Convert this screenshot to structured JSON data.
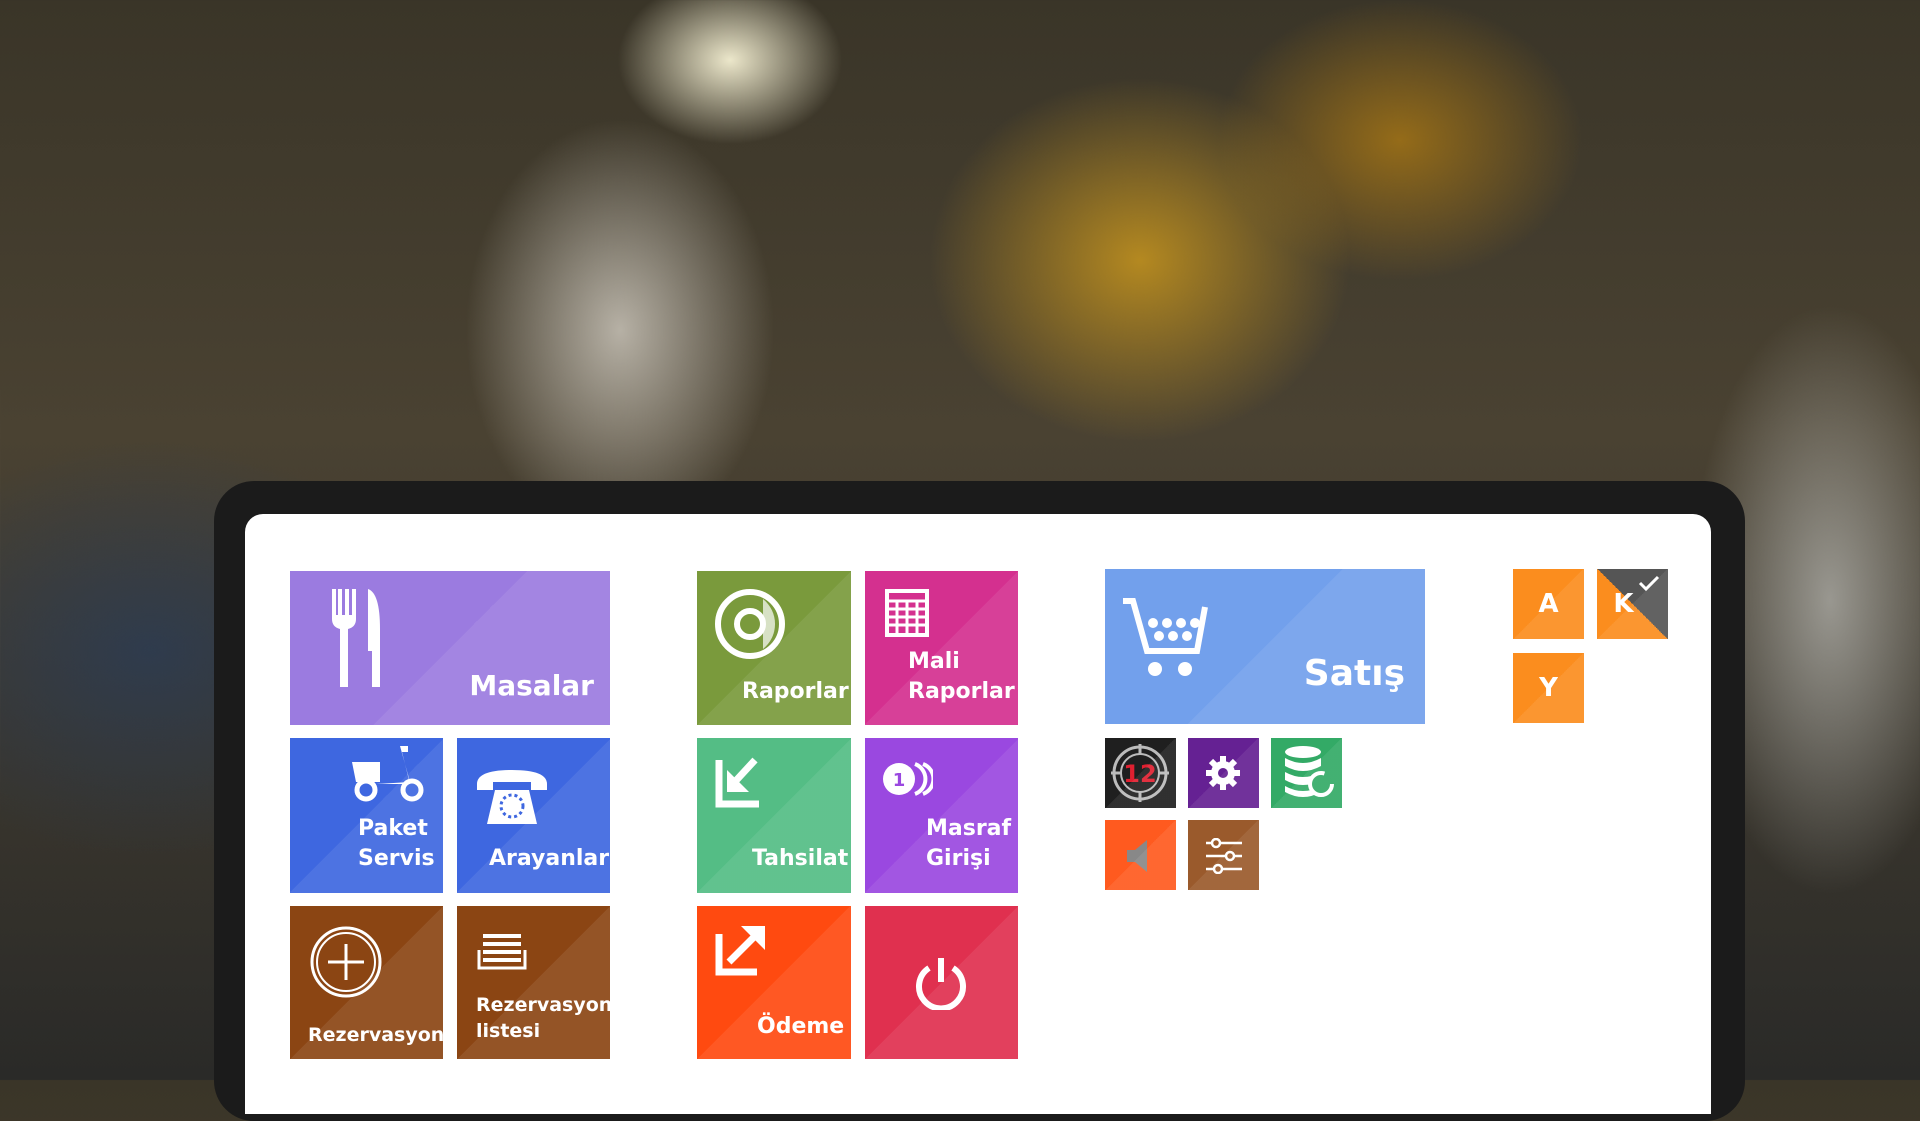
{
  "tiles": {
    "masalar": {
      "label": "Masalar",
      "color": "#9b7be0",
      "icon": "fork-knife-icon"
    },
    "paket_servis": {
      "label_line1": "Paket",
      "label_line2": "Servis",
      "color": "#3e67e0",
      "icon": "scooter-icon"
    },
    "arayanlar": {
      "label": "Arayanlar",
      "color": "#3e67e0",
      "icon": "telephone-icon"
    },
    "rezervasyon": {
      "label": "Rezervasyon",
      "color": "#8b4513",
      "icon": "clock-icon"
    },
    "rezervasyon_listesi": {
      "label_line1": "Rezervasyon",
      "label_line2": "listesi",
      "color": "#8b4513",
      "icon": "list-icon"
    },
    "raporlar": {
      "label": "Raporlar",
      "color": "#7a9a3c",
      "icon": "chart-disc-icon"
    },
    "mali_raporlar": {
      "label_line1": "Mali",
      "label_line2": "Raporlar",
      "color": "#d4308f",
      "icon": "calculator-icon"
    },
    "tahsilat": {
      "label": "Tahsilat",
      "color": "#54bd85",
      "icon": "arrow-in-icon"
    },
    "masraf_girisi": {
      "label_line1": "Masraf",
      "label_line2": "Girişi",
      "color": "#9a48e0",
      "icon": "coins-icon"
    },
    "odeme": {
      "label": "Ödeme",
      "color": "#ff4a10",
      "icon": "arrow-out-icon"
    },
    "power": {
      "color": "#e0304f",
      "icon": "power-icon"
    },
    "satis": {
      "label": "Satış",
      "color": "#72a0ec",
      "icon": "cart-icon"
    }
  },
  "small_tiles": [
    {
      "icon": "z-report-12-icon",
      "color": "#1f1f1f",
      "text": "12"
    },
    {
      "icon": "gear-icon",
      "color": "#652193"
    },
    {
      "icon": "database-restore-icon",
      "color": "#33aa66"
    },
    {
      "icon": "speaker-icon",
      "color": "#ff5a1f"
    },
    {
      "icon": "sliders-icon",
      "color": "#9a5a2c"
    }
  ],
  "letters": {
    "a": "A",
    "k": "K",
    "y": "Y",
    "k_checked": true
  }
}
